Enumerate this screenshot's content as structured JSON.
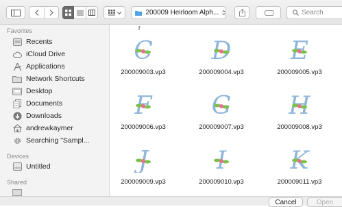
{
  "toolbar": {
    "path_label": "200009 Heirloom Alph...",
    "search_placeholder": "Search"
  },
  "sidebar": {
    "favorites_heading": "Favorites",
    "favorites": [
      {
        "label": "Recents",
        "icon": "recents-icon"
      },
      {
        "label": "iCloud Drive",
        "icon": "cloud-icon"
      },
      {
        "label": "Applications",
        "icon": "applications-icon"
      },
      {
        "label": "Network Shortcuts",
        "icon": "folder-icon"
      },
      {
        "label": "Desktop",
        "icon": "desktop-folder-icon"
      },
      {
        "label": "Documents",
        "icon": "documents-icon"
      },
      {
        "label": "Downloads",
        "icon": "downloads-icon"
      },
      {
        "label": "andrewkaymer",
        "icon": "home-icon"
      },
      {
        "label": "Searching \"Sampl...",
        "icon": "gear-icon"
      }
    ],
    "devices_heading": "Devices",
    "devices": [
      {
        "label": "Untitled",
        "icon": "disk-icon"
      }
    ],
    "shared_heading": "Shared"
  },
  "content": {
    "top_label": "f",
    "files": [
      {
        "name": "200009003.vp3",
        "letter": "C"
      },
      {
        "name": "200009004.vp3",
        "letter": "D"
      },
      {
        "name": "200009005.vp3",
        "letter": "E"
      },
      {
        "name": "200009006.vp3",
        "letter": "F"
      },
      {
        "name": "200009007.vp3",
        "letter": "G"
      },
      {
        "name": "200009008.vp3",
        "letter": "H"
      },
      {
        "name": "200009009.vp3",
        "letter": "J"
      },
      {
        "name": "200009010.vp3",
        "letter": "I"
      },
      {
        "name": "200009011.vp3",
        "letter": "K"
      }
    ]
  },
  "buttons": {
    "cancel": "Cancel",
    "open": "Open"
  },
  "colors": {
    "folder_blue": "#4ea6e6",
    "sidebar_bg": "#f3f3f3",
    "letter_blue": "#8fb6d9",
    "leaf_green": "#7cc24a",
    "flower_pink": "#e86f8f"
  }
}
